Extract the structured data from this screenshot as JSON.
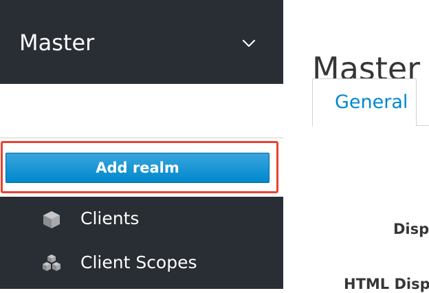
{
  "sidebar": {
    "realm_selector": {
      "current_realm": "Master"
    },
    "dropdown": {
      "add_realm_label": "Add realm"
    },
    "nav_items": [
      {
        "label": "Clients",
        "icon": "cube-icon"
      },
      {
        "label": "Client Scopes",
        "icon": "cubes-icon"
      }
    ]
  },
  "main": {
    "title": "Master",
    "tabs": [
      {
        "label": "General",
        "active": true
      }
    ],
    "form_labels": {
      "display_name": "Disp",
      "html_display_name": "HTML Disp"
    }
  },
  "colors": {
    "sidebar_bg": "#292e34",
    "accent_blue": "#0088ce",
    "highlight_red": "#e5432f"
  }
}
